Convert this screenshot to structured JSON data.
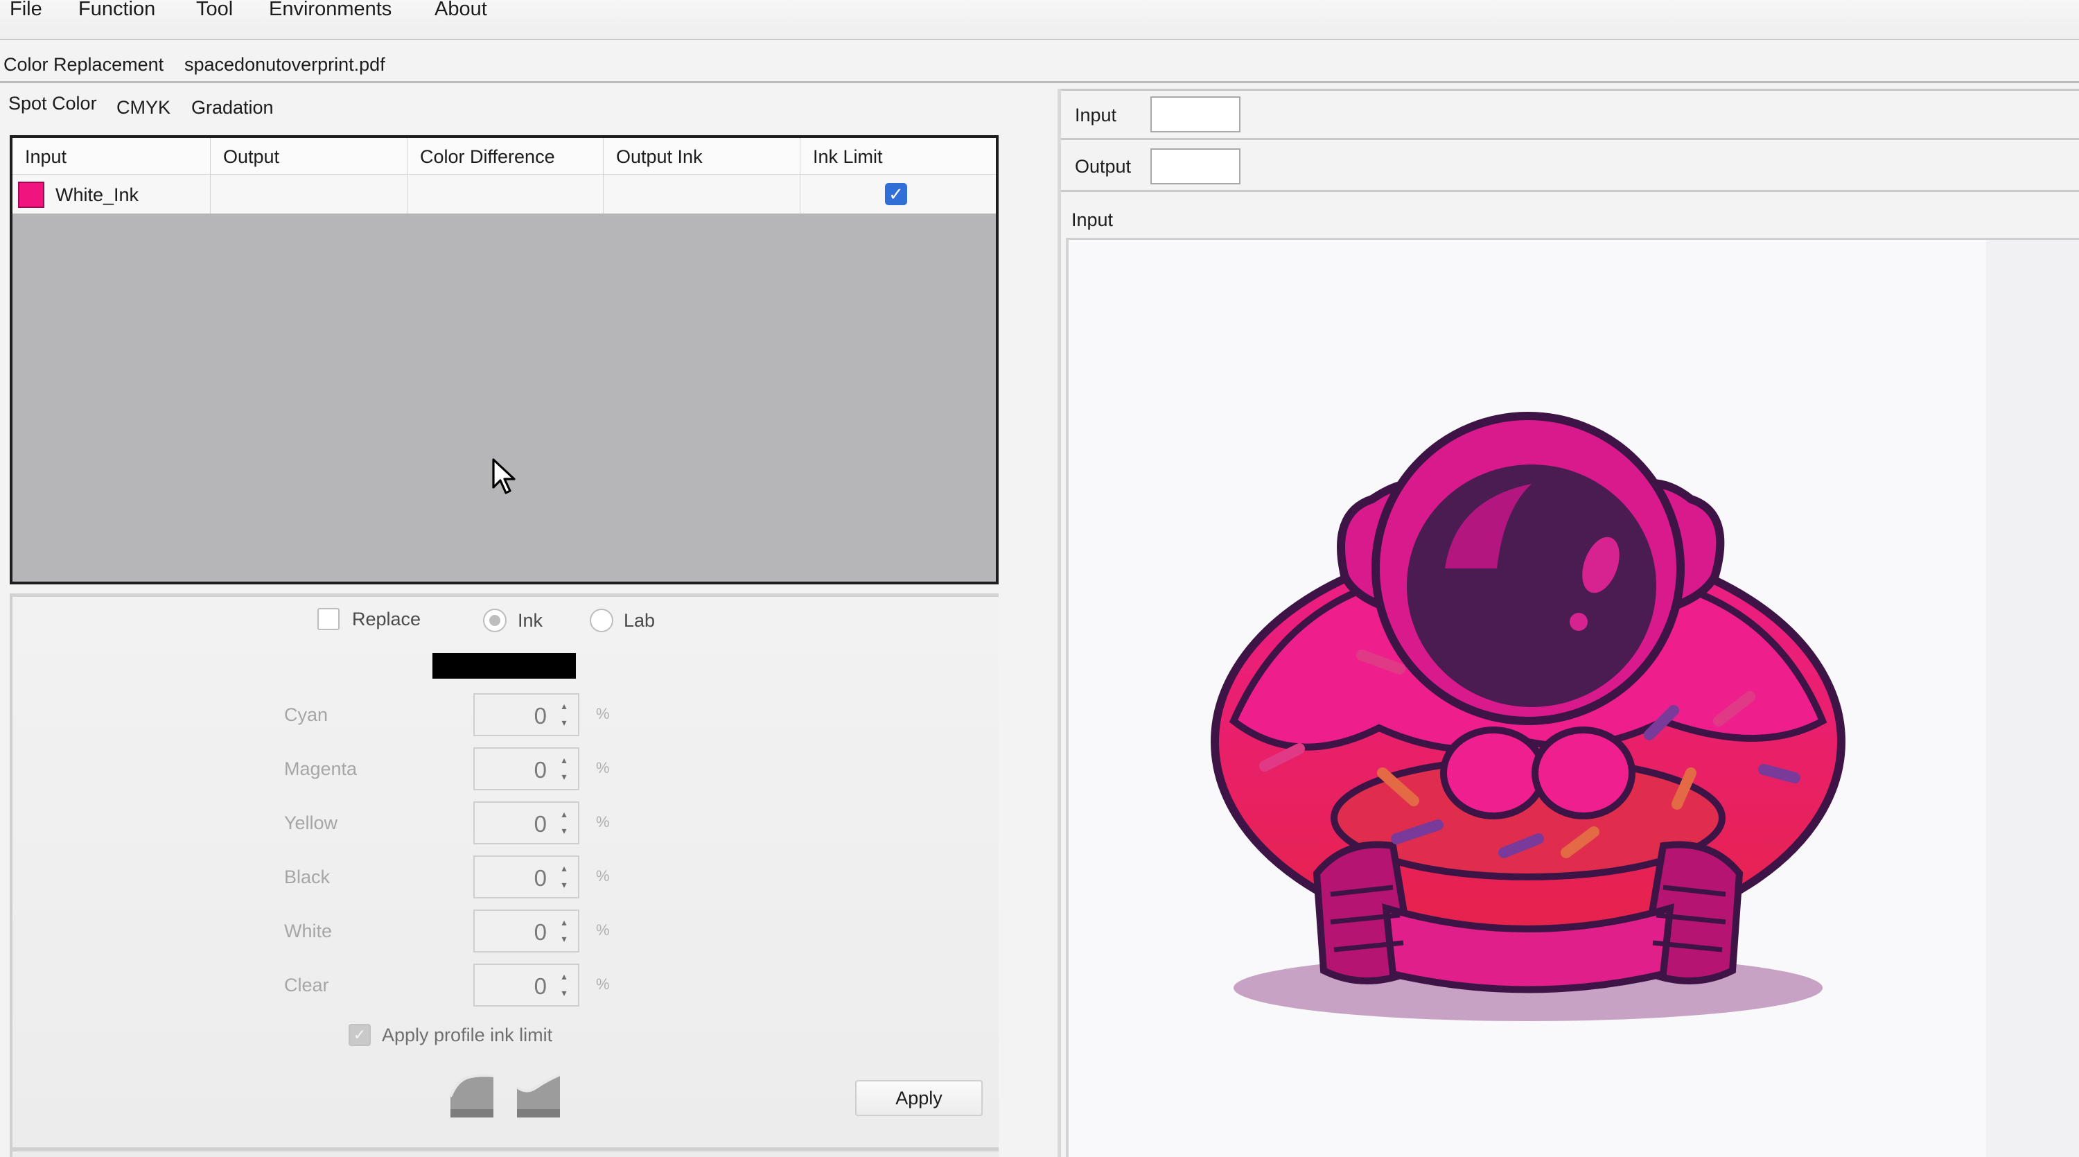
{
  "menu": [
    "File",
    "Function",
    "Tool",
    "Environments",
    "About"
  ],
  "title_row": {
    "module": "Color Replacement",
    "filename": "spacedonutoverprint.pdf"
  },
  "tabs": [
    "Spot Color",
    "CMYK",
    "Gradation"
  ],
  "table": {
    "columns": [
      "Input",
      "Output",
      "Color Difference",
      "Output Ink",
      "Ink Limit"
    ],
    "rows": [
      {
        "input": "White_Ink",
        "swatch_color": "#f0147f",
        "output": "",
        "color_difference": "",
        "output_ink": "",
        "ink_limit": true
      }
    ]
  },
  "options": {
    "replace_label": "Replace",
    "ink_label": "Ink",
    "lab_label": "Lab",
    "selected_mode": "Ink",
    "replace_checked": false
  },
  "channels": [
    {
      "label": "Cyan",
      "value": "0",
      "unit": "%"
    },
    {
      "label": "Magenta",
      "value": "0",
      "unit": "%"
    },
    {
      "label": "Yellow",
      "value": "0",
      "unit": "%"
    },
    {
      "label": "Black",
      "value": "0",
      "unit": "%"
    },
    {
      "label": "White",
      "value": "0",
      "unit": "%"
    },
    {
      "label": "Clear",
      "value": "0",
      "unit": "%"
    }
  ],
  "apply_profile_ink_limit": {
    "label": "Apply profile ink limit",
    "checked": true
  },
  "apply_button": "Apply",
  "right_panel": {
    "input_label": "Input",
    "output_label": "Output",
    "preview_label": "Input",
    "input_swatch": "#ffffff",
    "output_swatch": "#ffffff"
  },
  "colors": {
    "accent_check": "#2f6fd6",
    "donut_pink": "#ec1d8a",
    "helmet_purple": "#4a1c52"
  }
}
